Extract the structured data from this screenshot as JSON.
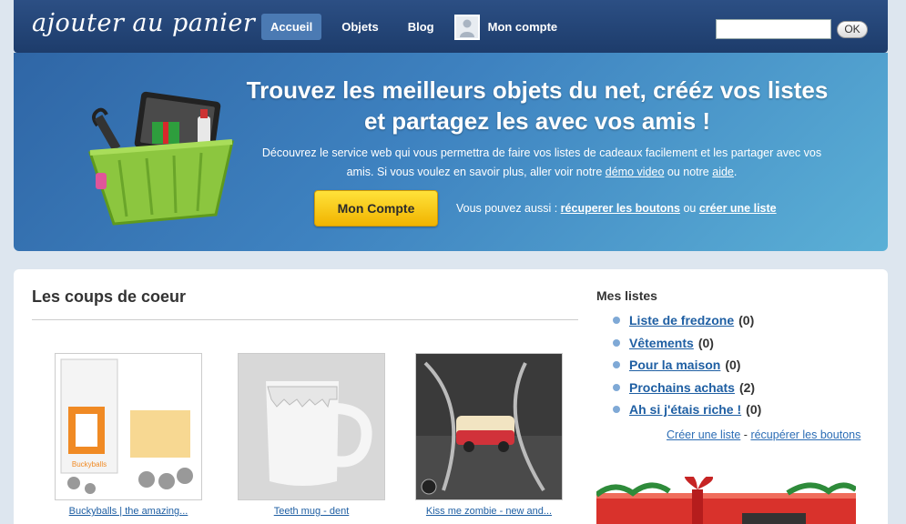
{
  "header": {
    "logo": "ajouter au panier",
    "nav": [
      "Accueil",
      "Objets",
      "Blog"
    ],
    "account_label": "Mon compte",
    "search_button": "OK"
  },
  "hero": {
    "title": "Trouvez les meilleurs objets du net, crééz vos listes et partagez les avec vos amis !",
    "desc_part1": "Découvrez le service web qui vous permettra de faire vos listes de cadeaux facilement et les partager avec vos amis. Si vous voulez en savoir plus, aller voir notre",
    "demo_link": "démo video",
    "desc_part2": "ou notre",
    "help_link": "aide",
    "desc_end": ".",
    "cta": "Mon Compte",
    "more_text": "Vous pouvez aussi :",
    "more_link1": "récuperer les boutons",
    "more_or": "ou",
    "more_link2": "créer une liste"
  },
  "main": {
    "section_title": "Les coups de coeur",
    "products": [
      {
        "name": "Buckyballs | the amazing..."
      },
      {
        "name": "Teeth mug - dent"
      },
      {
        "name": "Kiss me zombie - new and..."
      }
    ]
  },
  "sidebar": {
    "title": "Mes listes",
    "lists": [
      {
        "name": "Liste de fredzone",
        "count": "(0)"
      },
      {
        "name": "Vêtements",
        "count": "(0)"
      },
      {
        "name": "Pour la maison",
        "count": "(0)"
      },
      {
        "name": "Prochains achats",
        "count": "(2)"
      },
      {
        "name": "Ah si j'étais riche !",
        "count": "(0)"
      }
    ],
    "create_link": "Créer une liste",
    "separator": "-",
    "buttons_link": "récupérer les boutons"
  },
  "icons": [
    "user-avatar-icon",
    "basket-illustration",
    "gift-banner-illustration"
  ],
  "colors": {
    "header": "#1d3c6b",
    "nav_active": "#4b7ab3",
    "cta": "#f5c400",
    "link": "#1f5fa3"
  }
}
